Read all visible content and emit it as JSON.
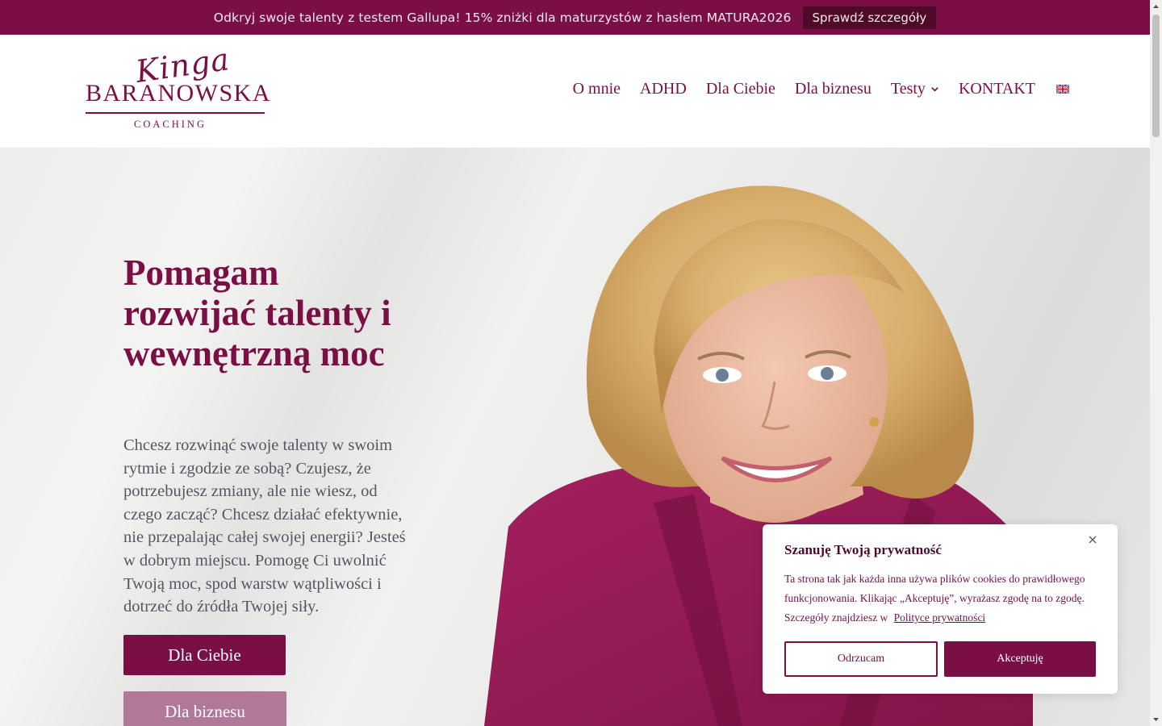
{
  "promo": {
    "text": "Odkryj swoje talenty z testem Gallupa! 15% zniżki dla maturzystów z hasłem MATURA2026",
    "button": "Sprawdź szczegóły"
  },
  "logo": {
    "script": "Kinga",
    "name": "BARANOWSKA",
    "sub": "COACHING"
  },
  "nav": {
    "items": [
      "O mnie",
      "ADHD",
      "Dla Ciebie",
      "Dla biznesu",
      "Testy",
      "KONTAKT"
    ],
    "language_icon": "uk-flag-icon"
  },
  "hero": {
    "title": "Pomagam rozwijać talenty i wewnętrzną moc",
    "text": "Chcesz rozwinąć swoje talenty w swoim rytmie i zgodzie ze sobą? Czujesz, że potrzebujesz zmiany, ale nie wiesz, od czego zacząć? Chcesz działać efektywnie, nie przepalając całej swojej energii? Jesteś w dobrym miejscu. Pomogę Ci uwolnić Twoją moc, spod warstw wątpliwości i dotrzeć do źródła Twojej siły.",
    "button_primary": "Dla Ciebie",
    "button_secondary": "Dla biznesu"
  },
  "cookie": {
    "title": "Szanuję Twoją prywatność",
    "text": "Ta strona tak jak każda inna używa plików cookies do prawidłowego funkcjonowania. Klikając „Akceptuję”, wyrażasz zgodę na to zgodę. Szczegóły znajdziesz w",
    "link": "Polityce prywatności",
    "reject": "Odrzucam",
    "accept": "Akceptuję"
  },
  "colors": {
    "brand": "#7a0f45",
    "brand_dark": "#4f0929",
    "button_secondary": "#b2789a"
  }
}
